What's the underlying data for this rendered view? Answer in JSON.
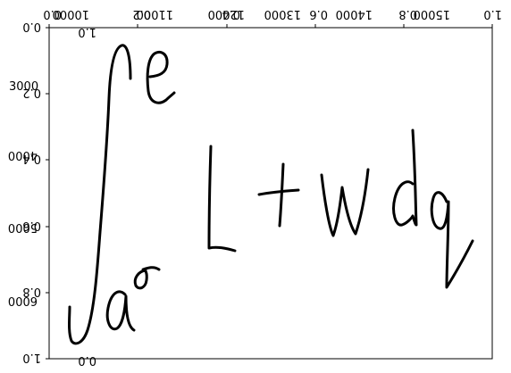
{
  "figure": {
    "stroke_color": "#000000",
    "background": "#ffffff"
  },
  "top_axis": {
    "labels_a": [
      "0.0",
      "0.2",
      "0.4",
      "0.6",
      "0.8",
      "1.0"
    ],
    "labels_b": [
      "10000",
      "11000",
      "12000",
      "13000",
      "14000",
      "15000"
    ]
  },
  "left_axis": {
    "labels_a": [
      "0.0",
      "0.2",
      "0.4",
      "0.6",
      "0.8",
      "1.0"
    ],
    "labels_b": [
      "3000",
      "4000",
      "5000",
      "6000"
    ]
  },
  "bottom_axis": {
    "labels": [
      "0.0",
      "1.0"
    ]
  },
  "handwriting": {
    "description_visible": false
  }
}
